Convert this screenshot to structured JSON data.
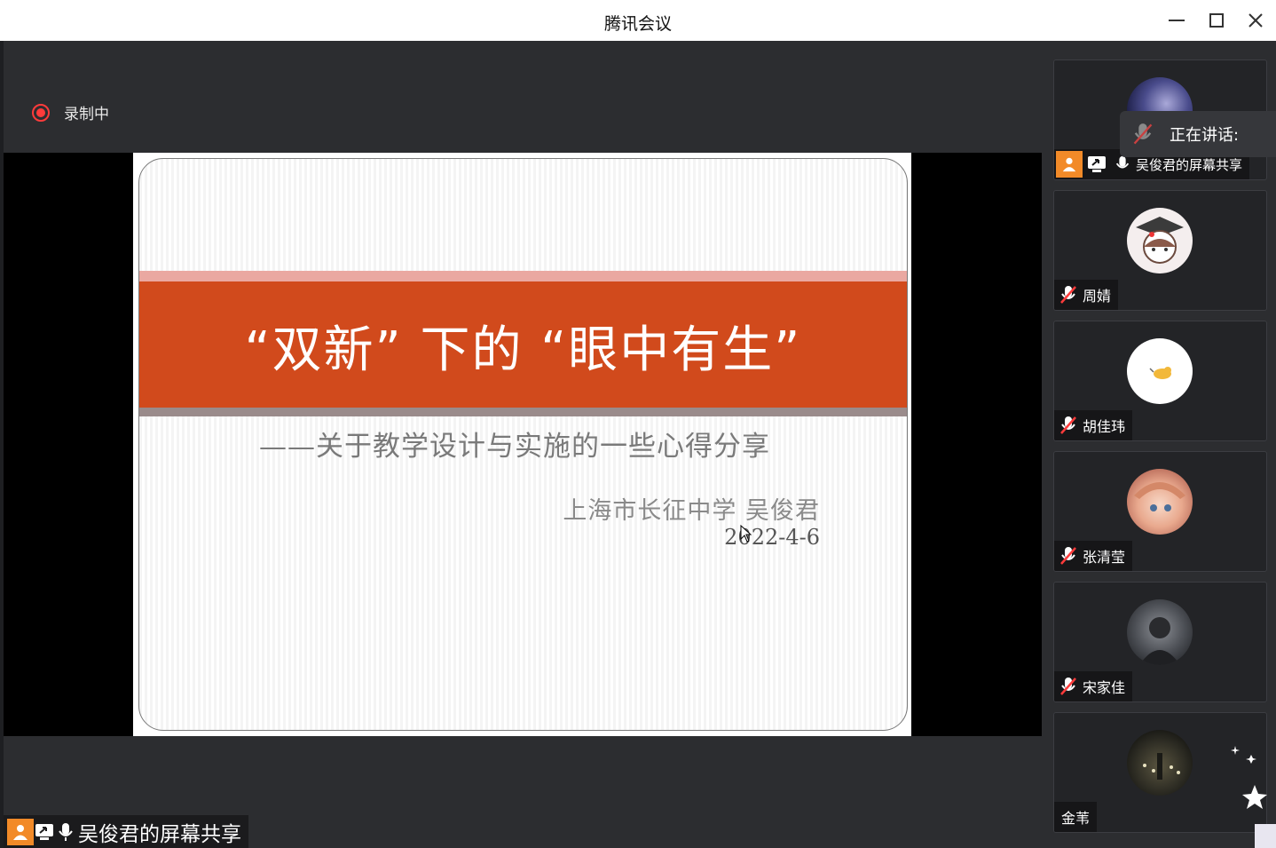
{
  "window": {
    "title": "腾讯会议"
  },
  "recording": {
    "label": "录制中"
  },
  "slide": {
    "title": "“双新” 下的 “眼中有生”",
    "subtitle": "——关于教学设计与实施的一些心得分享",
    "author": "上海市长征中学 吴俊君",
    "date": "2022-4-6"
  },
  "share_label": "吴俊君的屏幕共享",
  "speaking": {
    "label": "正在讲话:"
  },
  "participants": [
    {
      "name": "吴俊君的屏幕共享"
    },
    {
      "name": "周婧"
    },
    {
      "name": "胡佳玮"
    },
    {
      "name": "张清莹"
    },
    {
      "name": "宋家佳"
    },
    {
      "name": "金苇"
    }
  ],
  "colors": {
    "accent_orange": "#f28a28",
    "slide_band": "#d14a1c",
    "recording_red": "#ff3b3b"
  }
}
